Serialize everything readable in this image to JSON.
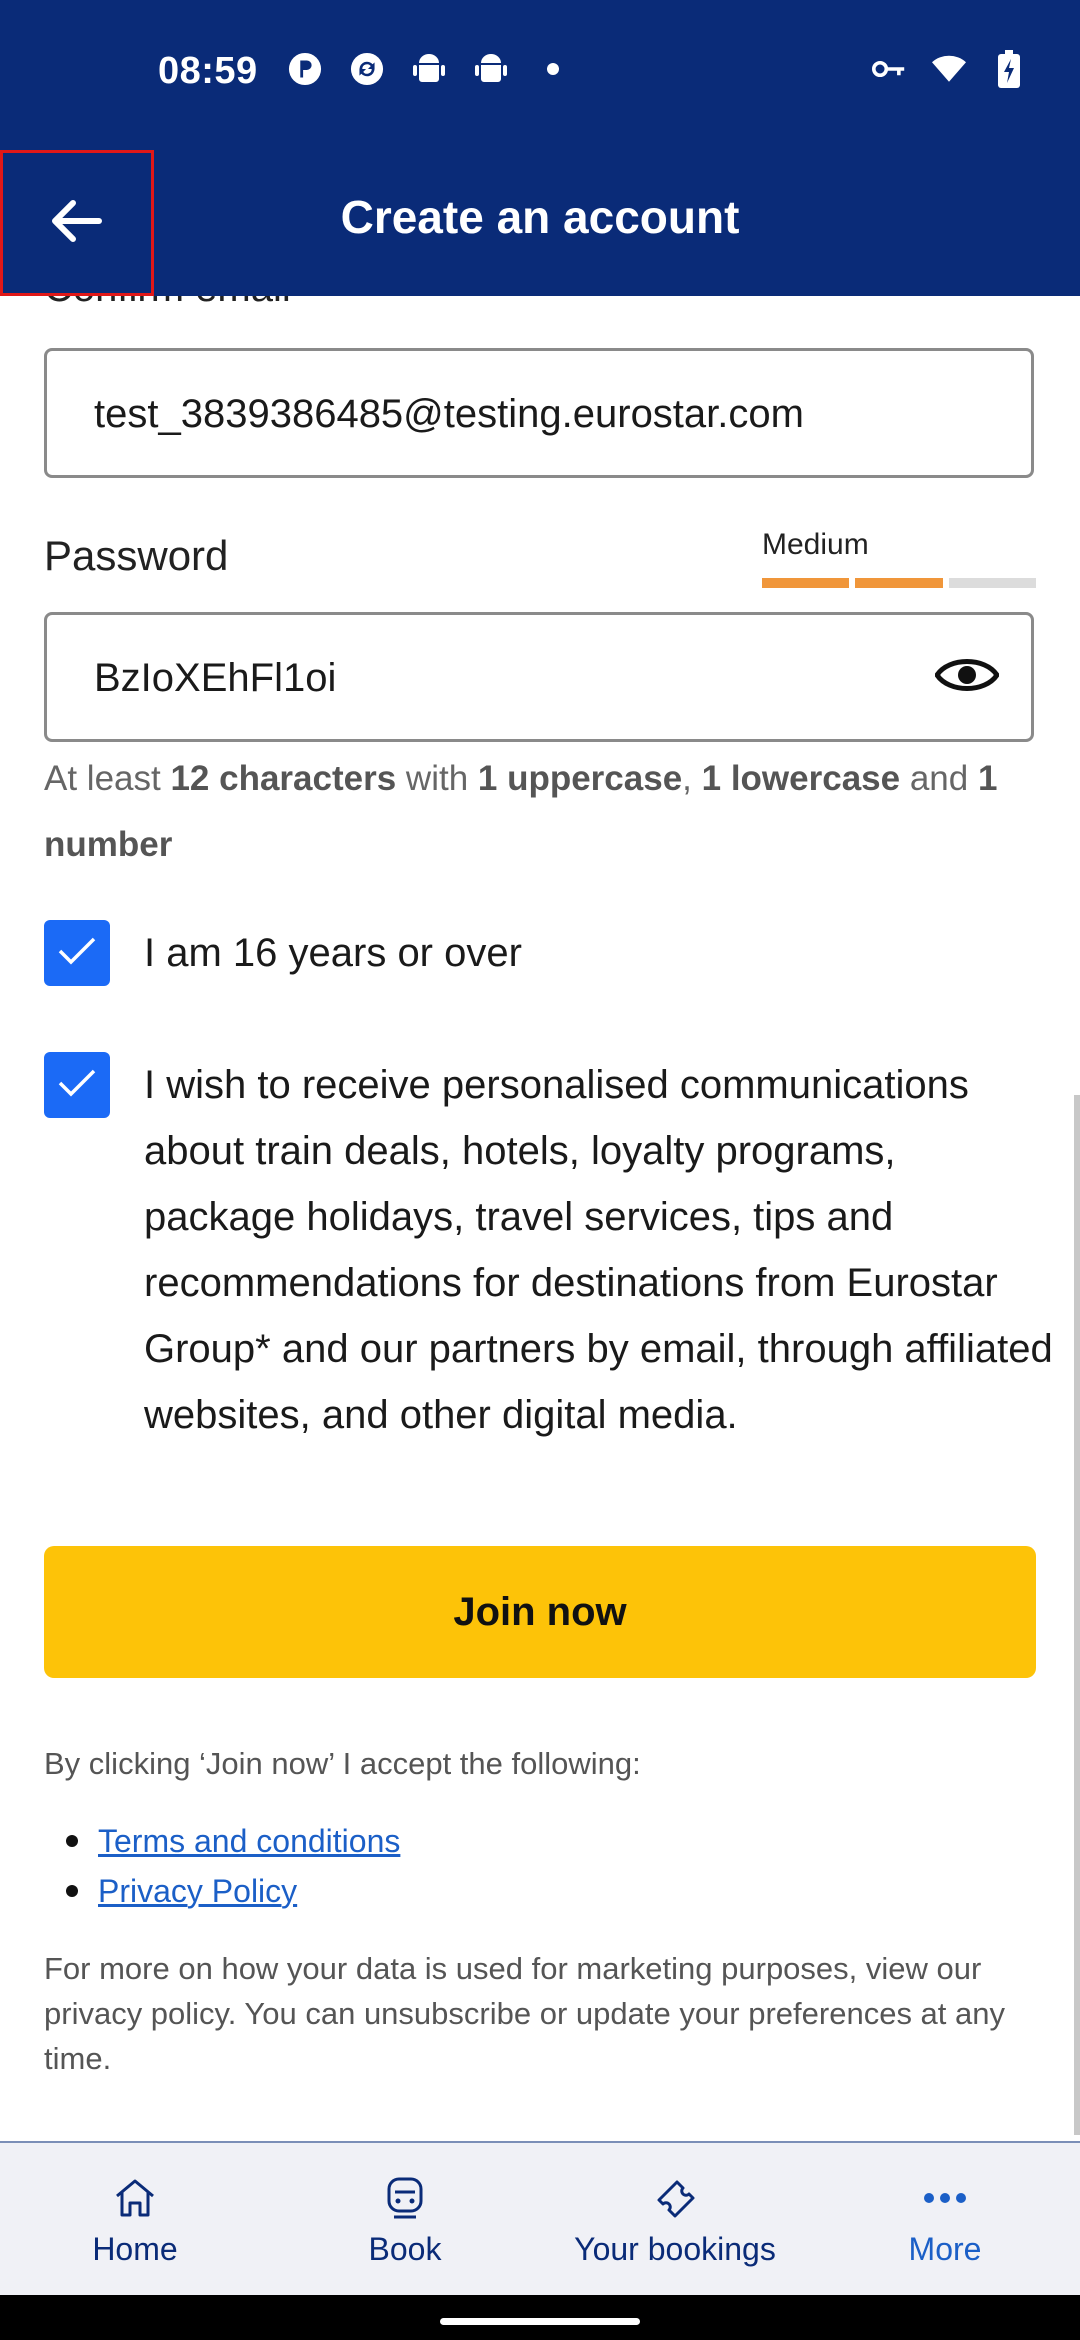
{
  "status_bar": {
    "time": "08:59",
    "left_icons": [
      "p-circle-icon",
      "sync-circle-icon",
      "android-icon",
      "android-icon",
      "dot-icon"
    ],
    "right_icons": [
      "key-icon",
      "wifi-icon",
      "battery-charging-icon"
    ]
  },
  "app_bar": {
    "title": "Create an account",
    "back_icon": "arrow-left-icon"
  },
  "form": {
    "confirm_email_label": "Confirm email",
    "confirm_email_value": "test_3839386485@testing.eurostar.com",
    "password_label": "Password",
    "password_value": "BzIoXEhFl1oi",
    "strength": {
      "label": "Medium",
      "level": 2,
      "total": 3,
      "colors": {
        "filled": "#f0963a",
        "empty": "#dcdcdc"
      }
    },
    "hint": {
      "p1": "At least ",
      "b1": "12 characters",
      "p2": " with ",
      "b2": "1 uppercase",
      "p3": ", ",
      "b3": "1 lowercase",
      "p4": " and ",
      "b4": "1 number"
    },
    "checkbox_age": {
      "label": "I am 16 years or over",
      "checked": true
    },
    "checkbox_marketing": {
      "label": "I wish to receive personalised communications about train deals, hotels, loyalty programs, package holidays, travel services, tips and recommendations for destinations from Eurostar Group* and our partners by email, through affiliated websites, and other digital media.",
      "checked": true
    },
    "join_button": "Join now",
    "accept_text": "By clicking ‘Join now’ I accept the following:",
    "links": [
      "Terms and conditions",
      "Privacy Policy"
    ],
    "footnote": "For more on how your data is used for marketing purposes, view our privacy policy. You can unsubscribe or update your preferences at any time."
  },
  "bottom_nav": {
    "items": [
      {
        "label": "Home",
        "icon": "home-icon"
      },
      {
        "label": "Book",
        "icon": "train-icon"
      },
      {
        "label": "Your bookings",
        "icon": "ticket-icon"
      },
      {
        "label": "More",
        "icon": "more-dots-icon"
      }
    ],
    "active_index": 3
  },
  "colors": {
    "brand_navy": "#0a2b78",
    "accent_blue": "#1b6af6",
    "join_yellow": "#fdc308",
    "link_blue": "#1b5fc7"
  }
}
